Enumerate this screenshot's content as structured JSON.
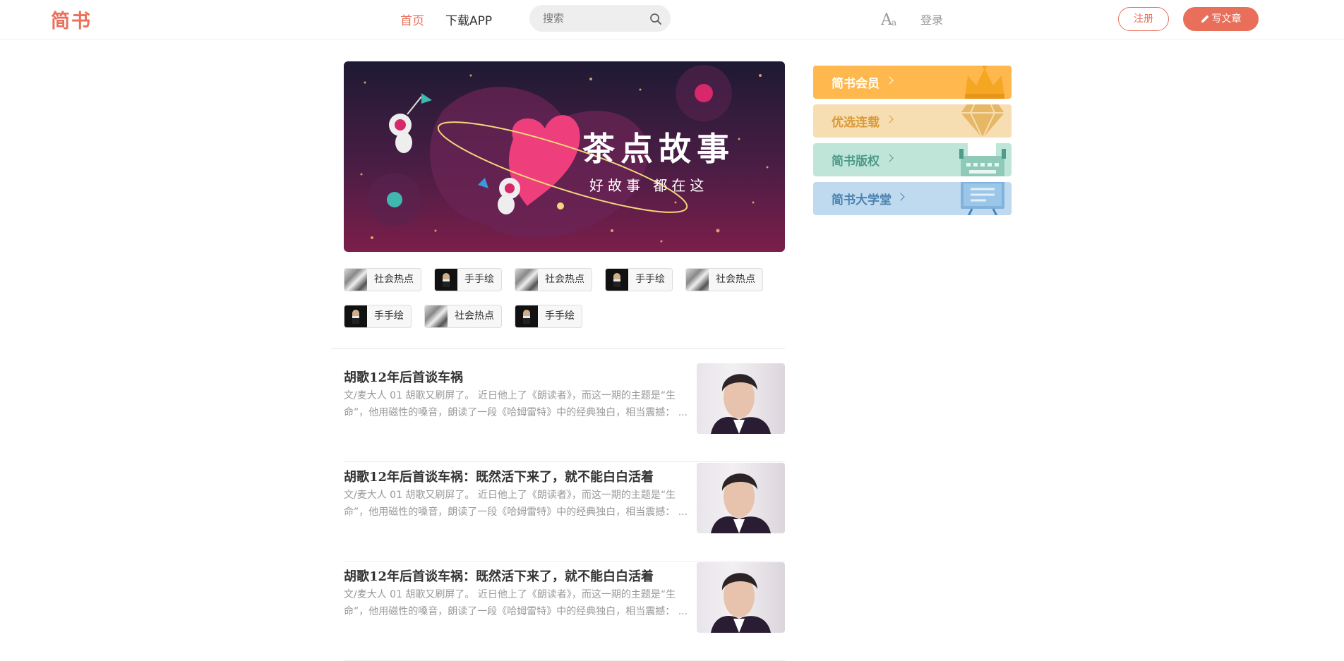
{
  "nav": {
    "logo": "简书",
    "home": "首页",
    "download_app": "下载APP",
    "search_placeholder": "搜索",
    "login": "登录",
    "register": "注册",
    "write": "写文章"
  },
  "banner": {
    "title": "茶点故事",
    "subtitle": "好故事 都在这"
  },
  "topics": [
    {
      "label": "社会热点",
      "thumb": "social"
    },
    {
      "label": "手手绘",
      "thumb": "hand"
    },
    {
      "label": "社会热点",
      "thumb": "social"
    },
    {
      "label": "手手绘",
      "thumb": "hand"
    },
    {
      "label": "社会热点",
      "thumb": "social"
    },
    {
      "label": "手手绘",
      "thumb": "hand"
    },
    {
      "label": "社会热点",
      "thumb": "social"
    },
    {
      "label": "手手绘",
      "thumb": "hand"
    }
  ],
  "articles": [
    {
      "title": "胡歌12年后首谈车祸",
      "abstract": "文/麦大人 01 胡歌又刷屏了。 近日他上了《朗读者》，而这一期的主题是“生命”，他用磁性的嗓音，朗读了一段《哈姆雷特》中的经典独白，相当震撼： ..."
    },
    {
      "title": "胡歌12年后首谈车祸：既然活下来了，就不能白白活着",
      "abstract": "文/麦大人 01 胡歌又刷屏了。 近日他上了《朗读者》，而这一期的主题是“生命”，他用磁性的嗓音，朗读了一段《哈姆雷特》中的经典独白，相当震撼： ..."
    },
    {
      "title": "胡歌12年后首谈车祸：既然活下来了，就不能白白活着",
      "abstract": "文/麦大人 01 胡歌又刷屏了。 近日他上了《朗读者》，而这一期的主题是“生命”，他用磁性的嗓音，朗读了一段《哈姆雷特》中的经典独白，相当震撼： ..."
    }
  ],
  "sidebar": [
    {
      "label": "简书会员",
      "icon": "crown-icon",
      "bg": "#ffb84d",
      "color": "#ffffff"
    },
    {
      "label": "优选连载",
      "icon": "diamond-icon",
      "bg": "#f7ddb2",
      "color": "#d99b35"
    },
    {
      "label": "简书版权",
      "icon": "typewriter-icon",
      "bg": "#bfe5d9",
      "color": "#4f9a89"
    },
    {
      "label": "简书大学堂",
      "icon": "blackboard-icon",
      "bg": "#bfd9ef",
      "color": "#4a82b0"
    }
  ],
  "colors": {
    "accent": "#ea6f5a"
  }
}
